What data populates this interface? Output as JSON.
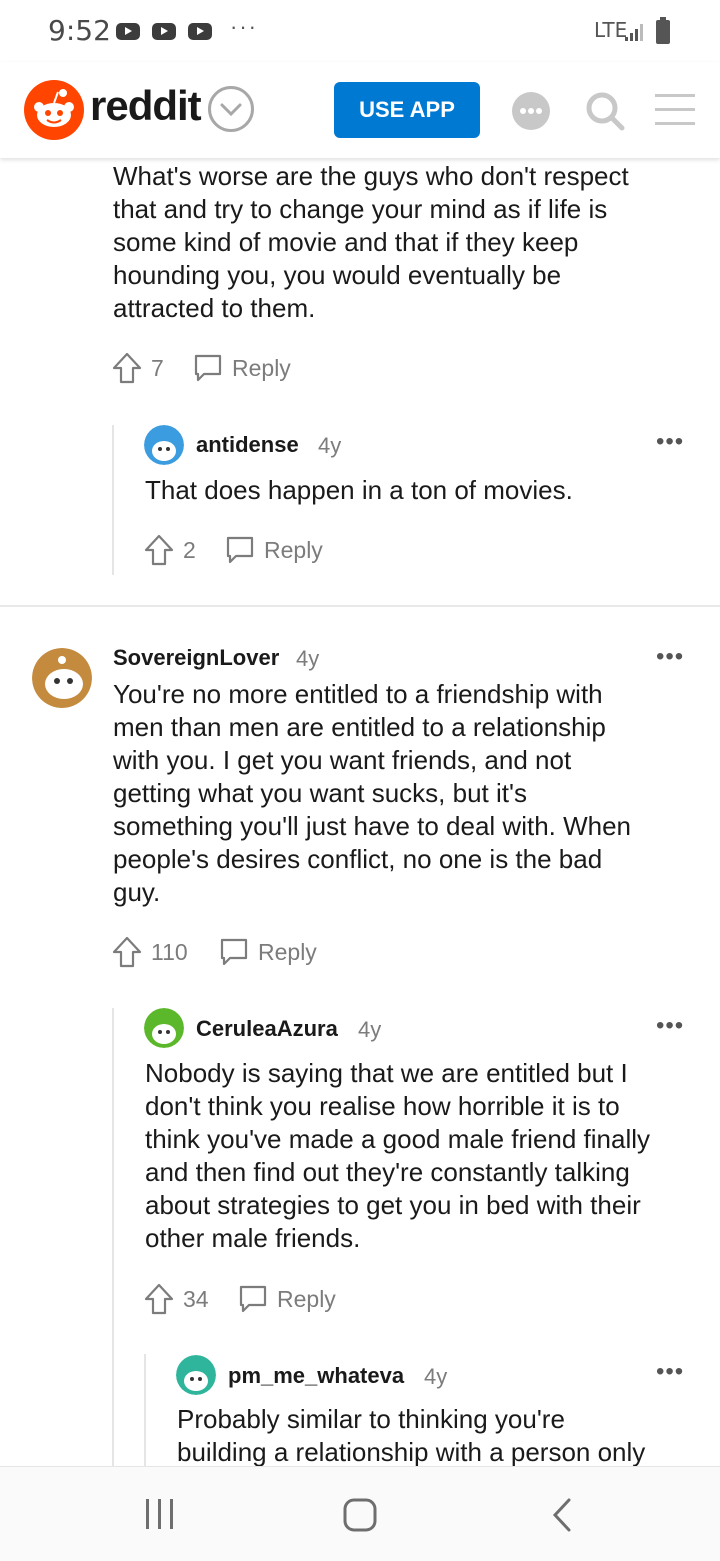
{
  "status_bar": {
    "time": "9:52",
    "more": "···",
    "network": "LTE"
  },
  "header": {
    "logo_text": "reddit",
    "use_app_label": "USE APP"
  },
  "comments": [
    {
      "id": "c0",
      "text_lines": [
        "What's worse are the guys who don't respect",
        "that and try to change your mind as if life is",
        "some kind of movie and that if they keep",
        "hounding you, you would eventually be",
        "attracted to them."
      ],
      "votes": "7",
      "reply_label": "Reply"
    },
    {
      "id": "c1",
      "username": "antidense",
      "age": "4y",
      "text_lines": [
        "That does happen in a ton of movies."
      ],
      "votes": "2",
      "reply_label": "Reply"
    },
    {
      "id": "c2",
      "username": "SovereignLover",
      "age": "4y",
      "text_lines": [
        "You're no more entitled to a friendship with",
        "men than men are entitled to a relationship",
        "with you. I get you want friends, and not",
        "getting what you want sucks, but it's",
        "something you'll just have to deal with. When",
        "people's desires conflict, no one is the bad",
        "guy."
      ],
      "votes": "110",
      "reply_label": "Reply"
    },
    {
      "id": "c3",
      "username": "CeruleaAzura",
      "age": "4y",
      "text_lines": [
        "Nobody is saying that we are entitled but I",
        "don't think you realise how horrible it is to",
        "think you've made a good male friend finally",
        "and then find out they're constantly talking",
        "about strategies to get you in bed with their",
        "other male friends."
      ],
      "votes": "34",
      "reply_label": "Reply"
    },
    {
      "id": "c4",
      "username": "pm_me_whateva",
      "age": "4y",
      "text_lines": [
        "Probably similar to thinking you're",
        "building a relationship with a person only"
      ]
    }
  ],
  "colors": {
    "accent": "#0079d3",
    "reddit_orange": "#ff4500",
    "muted": "#7c7c7c"
  }
}
